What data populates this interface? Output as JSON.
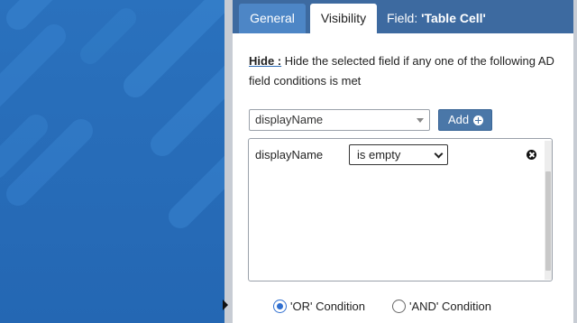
{
  "tabs": {
    "general_label": "General",
    "visibility_label": "Visibility"
  },
  "field_title": {
    "prefix": "Field: ",
    "name": "'Table Cell'"
  },
  "rule": {
    "hide_label": "Hide :",
    "description": "Hide the selected field if any one of the following AD field conditions is met"
  },
  "attribute_select": {
    "value": "displayName"
  },
  "add_button": {
    "label": "Add",
    "icon": "plus-circle-icon"
  },
  "conditions": [
    {
      "field": "displayName",
      "operator": "is empty",
      "remove_icon": "remove-circle-icon"
    }
  ],
  "logic": {
    "or_label": "'OR' Condition",
    "and_label": "'AND' Condition",
    "selected": "OR"
  },
  "colors": {
    "panel_header": "#3d6aa0",
    "tab_active": "#ffffff",
    "tab_inactive": "#4d86c6",
    "button": "#4a77a8",
    "radio_accent": "#2f6fd0",
    "left_background": "#2a71bd"
  }
}
